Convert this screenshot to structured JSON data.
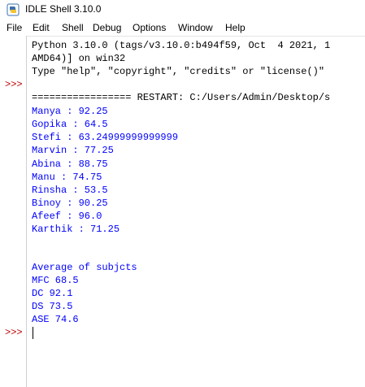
{
  "window": {
    "title": "IDLE Shell 3.10.0",
    "icon": "python-idle-icon"
  },
  "menu": [
    "File",
    "Edit",
    "Shell",
    "Debug",
    "Options",
    "Window",
    "Help"
  ],
  "shell": {
    "prompt": ">>>",
    "banner": [
      "Python 3.10.0 (tags/v3.10.0:b494f59, Oct  4 2021, 1",
      "AMD64)] on win32",
      "Type \"help\", \"copyright\", \"credits\" or \"license()\""
    ],
    "restart_line": "================= RESTART: C:/Users/Admin/Desktop/s",
    "output": [
      "Manya : 92.25",
      "Gopika : 64.5",
      "Stefi : 63.24999999999999",
      "Marvin : 77.25",
      "Abina : 88.75",
      "Manu : 74.75",
      "Rinsha : 53.5",
      "Binoy : 90.25",
      "Afeef : 96.0",
      "Karthik : 71.25",
      "",
      "",
      "Average of subjcts",
      "MFC 68.5",
      "DC 92.1",
      "DS 73.5",
      "ASE 74.6"
    ]
  },
  "colors": {
    "prompt": "#c00000",
    "program_output": "#0000ff",
    "banner_text": "#000000"
  }
}
